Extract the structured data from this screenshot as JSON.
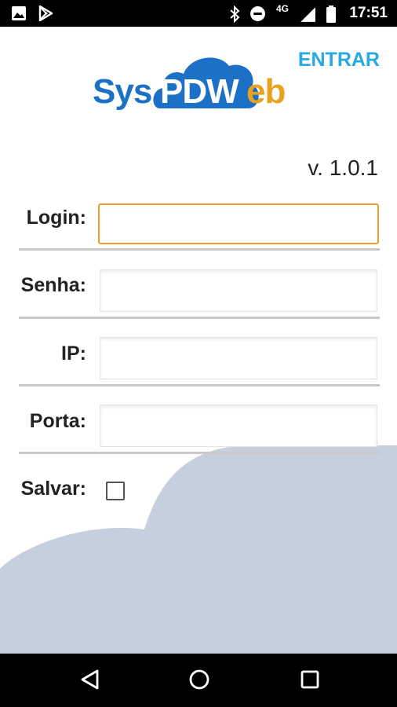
{
  "status_bar": {
    "time": "17:51",
    "network_label": "4G",
    "icons": [
      "image-icon",
      "play-store-icon",
      "bluetooth-icon",
      "do-not-disturb-icon",
      "signal-icon",
      "battery-icon"
    ]
  },
  "logo": {
    "part_sys": "Sys",
    "part_pdv": "PDW",
    "part_web": "eb"
  },
  "header": {
    "action_label": "ENTRAR"
  },
  "version": "v. 1.0.1",
  "form": {
    "login": {
      "label": "Login:",
      "value": ""
    },
    "senha": {
      "label": "Senha:",
      "value": ""
    },
    "ip": {
      "label": "IP:",
      "value": ""
    },
    "porta": {
      "label": "Porta:",
      "value": ""
    },
    "salvar": {
      "label": "Salvar:",
      "checked": false
    }
  },
  "nav": {
    "icons": [
      "back-icon",
      "home-icon",
      "recents-icon"
    ]
  },
  "colors": {
    "brand_blue": "#1c70c6",
    "brand_orange": "#e9a21e",
    "action_blue": "#27a9e1",
    "focus_orange": "#f29b28",
    "cloud_background": "#c5cfde"
  }
}
